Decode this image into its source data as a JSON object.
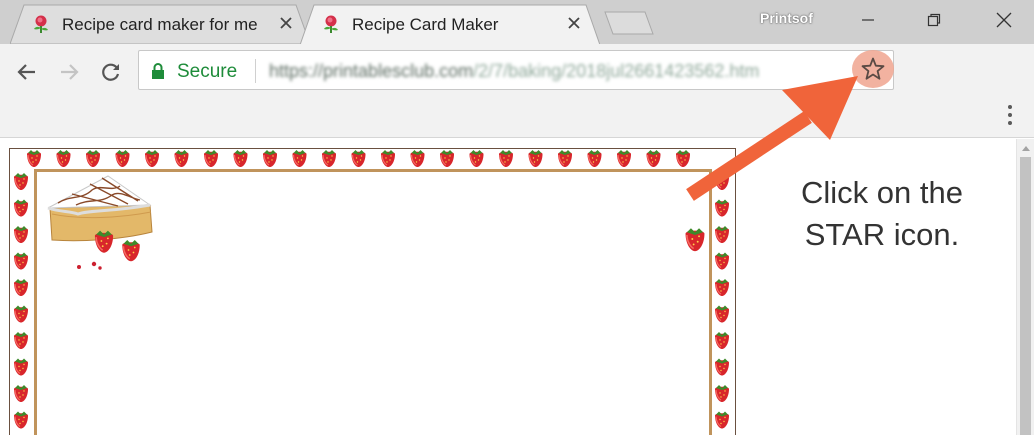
{
  "browser": {
    "tabs": [
      {
        "title": "Recipe card maker for me",
        "active": false
      },
      {
        "title": "Recipe Card Maker",
        "active": true
      }
    ],
    "profile_name": "Printsof",
    "secure_label": "Secure",
    "url_host": "https://printablesclub.com",
    "url_path": "/2/7/baking/2018jul2661423562.htm"
  },
  "annotation": {
    "callout_line1": "Click on the",
    "callout_line2": "STAR icon.",
    "accent_color": "#f0643a"
  },
  "page": {
    "card_theme": "strawberry border recipe card",
    "border_color": "#c0945c"
  }
}
